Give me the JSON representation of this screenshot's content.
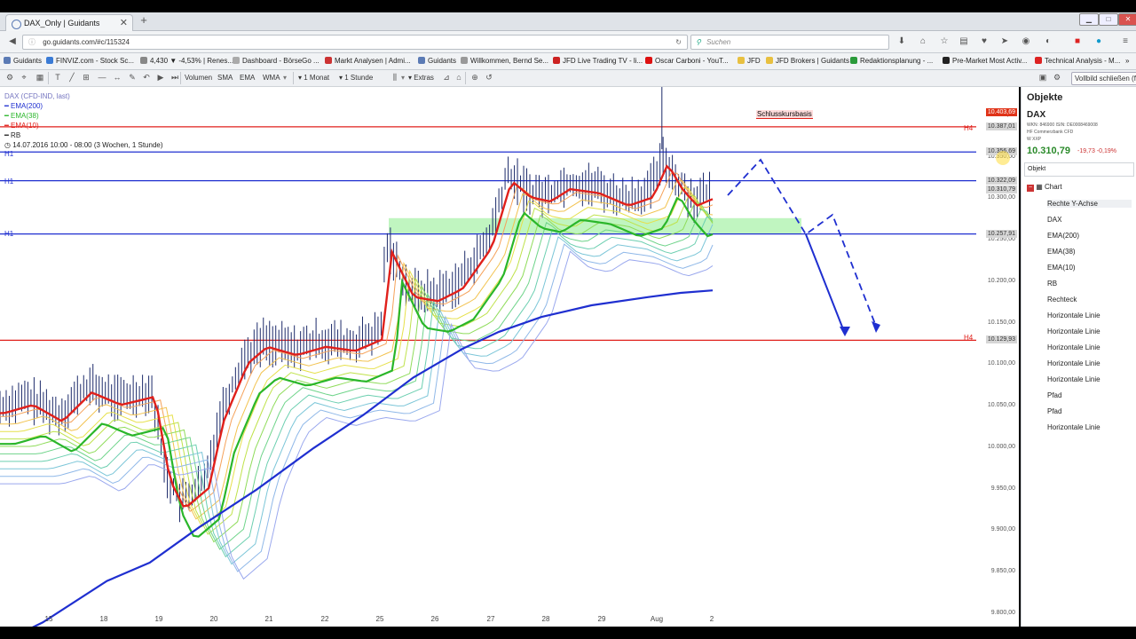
{
  "browser": {
    "tab_title": "DAX_Only | Guidants",
    "new_tab": "+",
    "url": "go.guidants.com/#c/115324",
    "search_placeholder": "Suchen",
    "bookmarks": [
      "Guidants",
      "FINVIZ.com - Stock Sc...",
      "4,430 ▼ -4,53% | Renes...",
      "Dashboard - BörseGo ...",
      "Markt Analysen | Admi...",
      "Guidants",
      "Willkommen, Bernd Se...",
      "JFD Live Trading TV - li...",
      "Oscar Carboni - YouT...",
      "JFD",
      "JFD Brokers | Guidants",
      "Redaktionsplanung - ...",
      "Pre-Market Most Activ...",
      "Technical Analysis - M..."
    ]
  },
  "toolbar": {
    "volumen": "Volumen",
    "sma": "SMA",
    "ema": "EMA",
    "wma": "WMA",
    "period": "1 Monat",
    "interval": "1 Stunde",
    "extras": "Extras",
    "fullscreen_close": "Vollbild schließen (f)"
  },
  "legend": {
    "instrument": "DAX (CFD-IND, last)",
    "ema200": "EMA(200)",
    "ema38": "EMA(38)",
    "ema10": "EMA(10)",
    "rb": "RB",
    "range": "14.07.2016 10:00 - 08:00 (3 Wochen, 1 Stunde)"
  },
  "annotations": {
    "schlusskursbasis": "Schlusskursbasis",
    "h1": "H1",
    "h4": "H4"
  },
  "colors": {
    "red": "#e0201b",
    "blue": "#1f2fd0",
    "green": "#2ab62a",
    "price_red": "#e03318"
  },
  "chart_data": {
    "type": "line",
    "instrument": "DAX (CFD-IND, last)",
    "x_ticks": [
      "15",
      "18",
      "19",
      "20",
      "21",
      "22",
      "25",
      "26",
      "27",
      "28",
      "29",
      "Aug",
      "2"
    ],
    "y_ticks": [
      "10.400,00",
      "10.350,00",
      "10.300,00",
      "10.250,00",
      "10.200,00",
      "10.150,00",
      "10.100,00",
      "10.050,00",
      "10.000,00",
      "9.950,00",
      "9.900,00",
      "9.850,00",
      "9.800,00"
    ],
    "ylim": [
      9785,
      10435
    ],
    "price_tags": [
      {
        "label": "10.403,69",
        "value": 10403.69,
        "color": "#e03318"
      },
      {
        "label": "10.387,01",
        "value": 10387.01,
        "color": "#999999"
      },
      {
        "label": "10.356,69",
        "value": 10356.69,
        "color": "#999999"
      },
      {
        "label": "10.322,09",
        "value": 10322.09,
        "color": "#999999"
      },
      {
        "label": "10.310,79",
        "value": 10310.79,
        "color": "#999999"
      },
      {
        "label": "10.257,91",
        "value": 10257.91,
        "color": "#999999"
      },
      {
        "label": "10.129,93",
        "value": 10129.93,
        "color": "#999999"
      }
    ],
    "horizontal_lines": [
      {
        "value": 10387.01,
        "color": "#e0201b",
        "label": "H4"
      },
      {
        "value": 10356.69,
        "color": "#1f2fd0",
        "label": "H1"
      },
      {
        "value": 10322.09,
        "color": "#1f2fd0",
        "label": "H1"
      },
      {
        "value": 10257.91,
        "color": "#1f2fd0",
        "label": "H1"
      },
      {
        "value": 10129.93,
        "color": "#e0201b",
        "label": "H4"
      }
    ],
    "zone": {
      "from": 10257.91,
      "to": 10277
    },
    "ema200": [
      [
        0,
        9765
      ],
      [
        0.06,
        9790
      ],
      [
        0.15,
        9840
      ],
      [
        0.21,
        9862
      ],
      [
        0.28,
        9905
      ],
      [
        0.36,
        9950
      ],
      [
        0.44,
        10000
      ],
      [
        0.51,
        10040
      ],
      [
        0.58,
        10085
      ],
      [
        0.65,
        10120
      ],
      [
        0.7,
        10140
      ],
      [
        0.76,
        10158
      ],
      [
        0.83,
        10172
      ],
      [
        0.91,
        10182
      ],
      [
        0.955,
        10187
      ],
      [
        1,
        10190
      ]
    ]
  },
  "panel": {
    "title": "Objekte",
    "symbol": "DAX",
    "wkn": "WKN: 846900  ISIN: DE0008469008",
    "info1": "HF  Commerzbank CFD",
    "info2": "W  XXP",
    "price": "10.310,79",
    "change": "-19,73  -0,19%",
    "object_label": "Objekt",
    "tree_root": "Chart",
    "items": [
      "Rechte Y-Achse",
      "DAX",
      "EMA(200)",
      "EMA(38)",
      "EMA(10)",
      "RB",
      "Rechteck",
      "Horizontale Linie",
      "Horizontale Linie",
      "Horizontale Linie",
      "Horizontale Linie",
      "Horizontale Linie",
      "Pfad",
      "Pfad",
      "Horizontale Linie"
    ]
  }
}
